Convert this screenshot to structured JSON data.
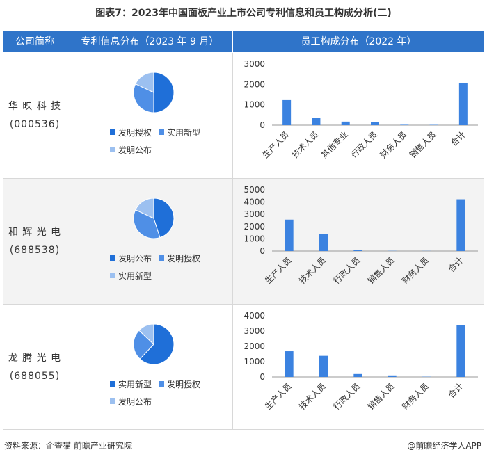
{
  "title": "图表7：2023年中国面板产业上市公司专利信息和员工构成分析(二)",
  "headers": [
    "公司简称",
    "专利信息分布（2023 年 9 月）",
    "员工构成分布（2022 年）"
  ],
  "companies": [
    {
      "name": "华 映 科 技",
      "code": "(000536)"
    },
    {
      "name": "和 辉 光 电",
      "code": "(688538)"
    },
    {
      "name": "龙 腾 光 电",
      "code": "(688055)"
    }
  ],
  "colors": {
    "header": "#2f74c9",
    "bar": "#3b82e0",
    "pie": [
      "#1f6fd8",
      "#4f8fe6",
      "#9cc0f0"
    ],
    "rowAlt": "#f3f3f3"
  },
  "chart_data": [
    {
      "type": "pie",
      "labels": [
        "发明授权",
        "实用新型",
        "发明公布"
      ],
      "values": [
        50,
        32,
        18
      ]
    },
    {
      "type": "bar",
      "categories": [
        "生产人员",
        "技术人员",
        "其他专业",
        "行政人员",
        "财务人员",
        "销售人员",
        "合计"
      ],
      "values": [
        1230,
        350,
        175,
        150,
        20,
        15,
        2080
      ],
      "ylim": [
        0,
        3000
      ],
      "yticks": [
        0,
        1000,
        2000,
        3000
      ]
    },
    {
      "type": "pie",
      "labels": [
        "发明公布",
        "发明授权",
        "实用新型"
      ],
      "values": [
        45,
        37,
        18
      ]
    },
    {
      "type": "bar",
      "categories": [
        "生产人员",
        "技术人员",
        "行政人员",
        "销售人员",
        "财务人员",
        "合计"
      ],
      "values": [
        2570,
        1400,
        75,
        15,
        10,
        4230
      ],
      "ylim": [
        0,
        5000
      ],
      "yticks": [
        0,
        1000,
        2000,
        3000,
        4000,
        5000
      ]
    },
    {
      "type": "pie",
      "labels": [
        "实用新型",
        "发明授权",
        "发明公布"
      ],
      "values": [
        62,
        25,
        13
      ]
    },
    {
      "type": "bar",
      "categories": [
        "生产人员",
        "技术人员",
        "行政人员",
        "销售人员",
        "财务人员",
        "合计"
      ],
      "values": [
        1680,
        1380,
        190,
        100,
        15,
        3390
      ],
      "ylim": [
        0,
        4000
      ],
      "yticks": [
        0,
        1000,
        2000,
        3000,
        4000
      ]
    }
  ],
  "footer": {
    "source": "资料来源：企查猫 前瞻产业研究院",
    "brand": "@前瞻经济学人APP"
  }
}
